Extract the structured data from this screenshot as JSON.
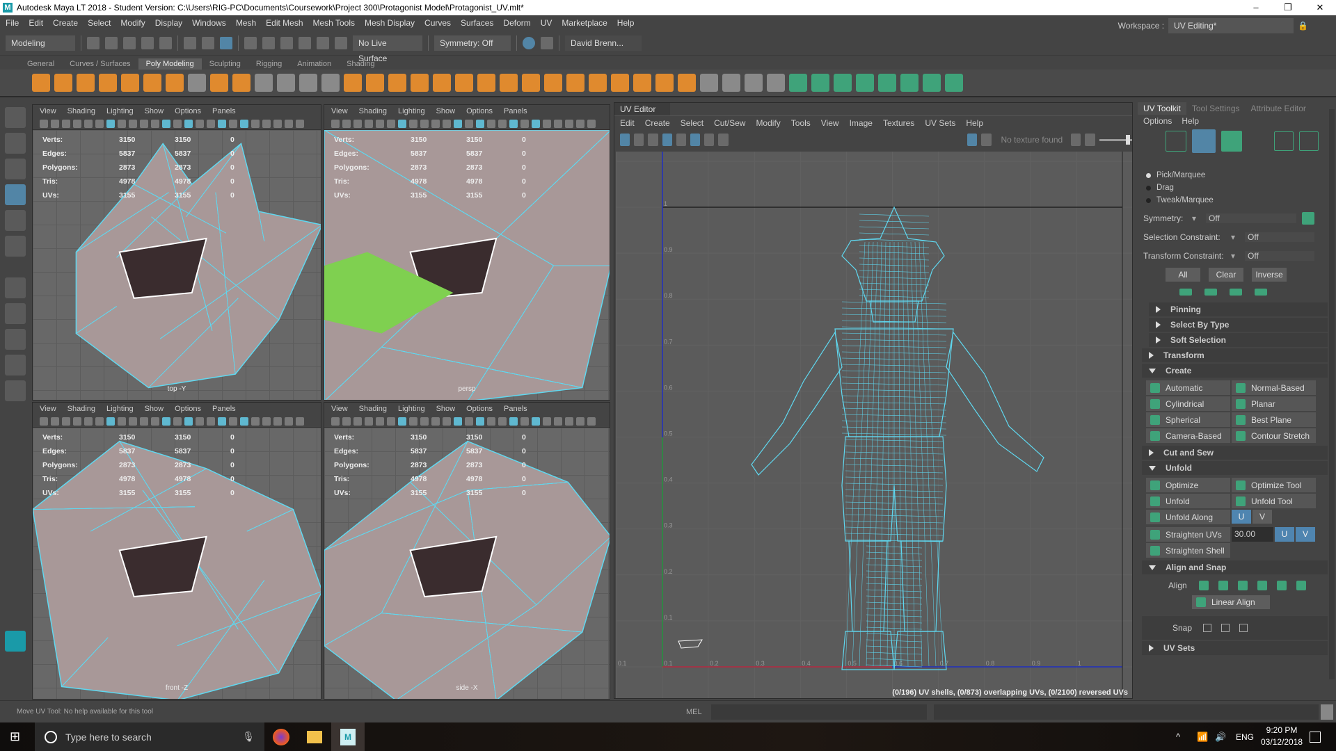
{
  "window": {
    "title": "Autodesk Maya LT 2018 - Student Version: C:\\Users\\RIG-PC\\Documents\\Coursework\\Project 300\\Protagonist Model\\Protagonist_UV.mlt*",
    "logo": "M",
    "minimize": "–",
    "maximize": "❐",
    "close": "✕"
  },
  "menubar": [
    "File",
    "Edit",
    "Create",
    "Select",
    "Modify",
    "Display",
    "Windows",
    "Mesh",
    "Edit Mesh",
    "Mesh Tools",
    "Mesh Display",
    "Curves",
    "Surfaces",
    "Deform",
    "UV",
    "Marketplace",
    "Help"
  ],
  "statusline": {
    "mode": "Modeling",
    "live_surface": "No Live Surface",
    "symmetry": "Symmetry: Off",
    "user": "David Brenn..."
  },
  "workspace": {
    "label": "Workspace :",
    "value": "UV Editing*"
  },
  "shelf": {
    "tabs": [
      "General",
      "Curves / Surfaces",
      "Poly Modeling",
      "Sculpting",
      "Rigging",
      "Animation",
      "Shading"
    ],
    "active": "Poly Modeling"
  },
  "viewport_menu": [
    "View",
    "Shading",
    "Lighting",
    "Show",
    "Options",
    "Panels"
  ],
  "hud": {
    "rows": [
      {
        "k": "Verts:",
        "a": "3150",
        "b": "3150",
        "c": "0"
      },
      {
        "k": "Edges:",
        "a": "5837",
        "b": "5837",
        "c": "0"
      },
      {
        "k": "Polygons:",
        "a": "2873",
        "b": "2873",
        "c": "0"
      },
      {
        "k": "Tris:",
        "a": "4978",
        "b": "4978",
        "c": "0"
      },
      {
        "k": "UVs:",
        "a": "3155",
        "b": "3155",
        "c": "0"
      }
    ]
  },
  "viewports": [
    {
      "camera": "top -Y"
    },
    {
      "camera": "persp"
    },
    {
      "camera": "front -Z"
    },
    {
      "camera": "side -X"
    }
  ],
  "uv_editor": {
    "title": "UV Editor",
    "menu": [
      "Edit",
      "Create",
      "Select",
      "Cut/Sew",
      "Modify",
      "Tools",
      "View",
      "Image",
      "Textures",
      "UV Sets",
      "Help"
    ],
    "texture": "No texture found",
    "u_ticks": [
      "0.1",
      "0.1",
      "0.2",
      "0.3",
      "0.4",
      "0.5",
      "0.6",
      "0.7",
      "0.8",
      "0.9",
      "1"
    ],
    "v_ticks": [
      "0.1",
      "0.2",
      "0.3",
      "0.4",
      "0.5",
      "0.6",
      "0.7",
      "0.8",
      "0.9",
      "1"
    ],
    "status": "(0/196) UV shells, (0/873) overlapping UVs, (0/2100) reversed UVs",
    "colors": {
      "wire": "#5fd8f0",
      "u_axis": "#c03030",
      "v_axis": "#2f9a2f",
      "border": "#2030c0"
    }
  },
  "toolkit": {
    "tabs": [
      "UV Toolkit",
      "Tool Settings",
      "Attribute Editor"
    ],
    "menu": [
      "Options",
      "Help"
    ],
    "modes": [
      "Pick/Marquee",
      "Drag",
      "Tweak/Marquee"
    ],
    "symmetry": {
      "label": "Symmetry:",
      "value": "Off"
    },
    "selection_constraint": {
      "label": "Selection Constraint:",
      "value": "Off"
    },
    "transform_constraint": {
      "label": "Transform Constraint:",
      "value": "Off"
    },
    "select_buttons": [
      "All",
      "Clear",
      "Inverse"
    ],
    "subsections": [
      "Pinning",
      "Select By Type",
      "Soft Selection"
    ],
    "transform": "Transform",
    "create": {
      "title": "Create",
      "buttons": [
        "Automatic",
        "Normal-Based",
        "Cylindrical",
        "Planar",
        "Spherical",
        "Best Plane",
        "Camera-Based",
        "Contour Stretch"
      ]
    },
    "cut_and_sew": "Cut and Sew",
    "unfold": {
      "title": "Unfold",
      "optimize": "Optimize",
      "optimize_tool": "Optimize Tool",
      "unfold": "Unfold",
      "unfold_tool": "Unfold Tool",
      "unfold_along": "Unfold Along",
      "u": "U",
      "v": "V",
      "straighten_uvs": "Straighten UVs",
      "angle": "30.00",
      "straighten_shell": "Straighten Shell"
    },
    "align_snap": {
      "title": "Align and Snap",
      "align": "Align",
      "linear_align": "Linear Align",
      "snap": "Snap"
    },
    "uv_sets": "UV Sets"
  },
  "helpline": {
    "text": "Move UV Tool: No help available for this tool",
    "mel": "MEL"
  },
  "taskbar": {
    "search": "Type here to search",
    "lang": "ENG",
    "time": "9:20 PM",
    "date": "03/12/2018"
  }
}
